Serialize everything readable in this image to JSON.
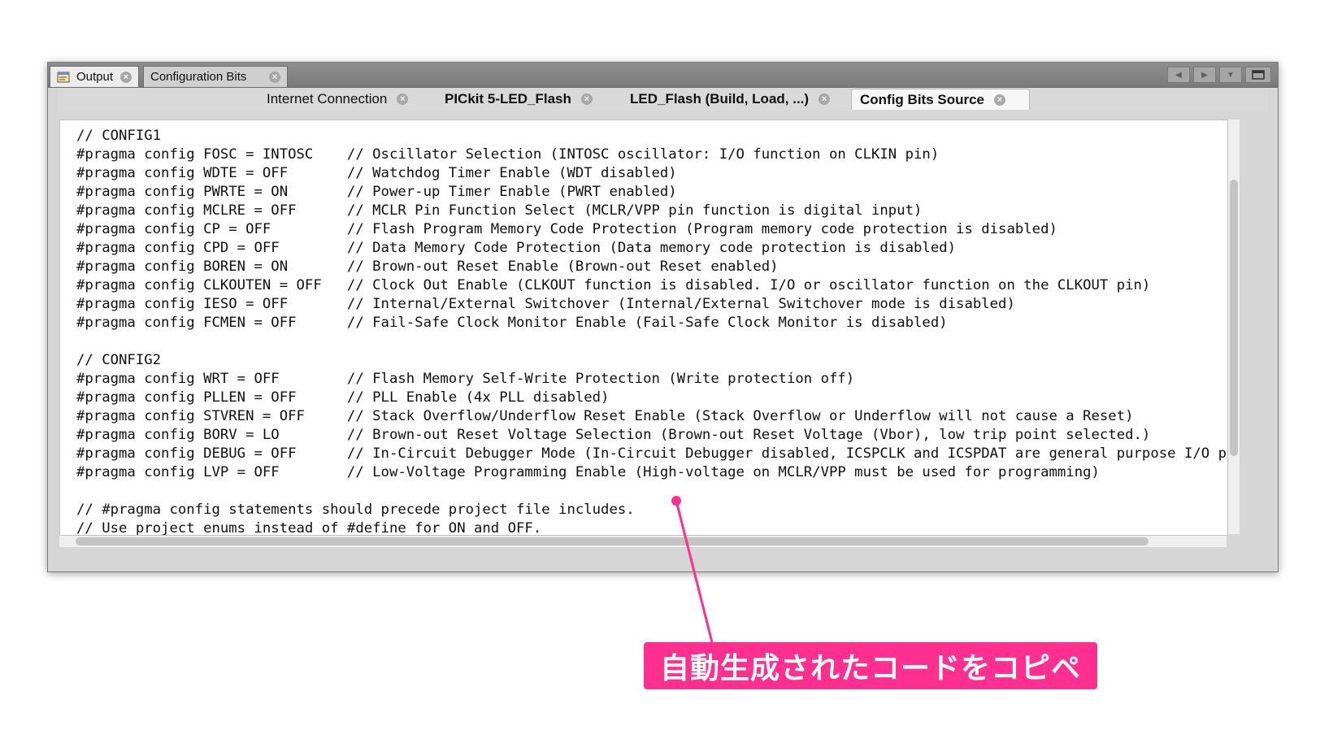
{
  "top_tabs": [
    {
      "label": "Output",
      "icon": "output-window-icon"
    },
    {
      "label": "Configuration Bits"
    }
  ],
  "window_controls": [
    "scroll-left-icon",
    "scroll-right-icon",
    "dropdown-icon",
    "maximize-icon"
  ],
  "sub_tabs": [
    {
      "label": "Internet Connection"
    },
    {
      "label": "PICkit 5-LED_Flash"
    },
    {
      "label": "LED_Flash (Build, Load, ...)"
    },
    {
      "label": "Config Bits Source"
    }
  ],
  "editor": {
    "lines": [
      "// CONFIG1",
      "#pragma config FOSC = INTOSC    // Oscillator Selection (INTOSC oscillator: I/O function on CLKIN pin)",
      "#pragma config WDTE = OFF       // Watchdog Timer Enable (WDT disabled)",
      "#pragma config PWRTE = ON       // Power-up Timer Enable (PWRT enabled)",
      "#pragma config MCLRE = OFF      // MCLR Pin Function Select (MCLR/VPP pin function is digital input)",
      "#pragma config CP = OFF         // Flash Program Memory Code Protection (Program memory code protection is disabled)",
      "#pragma config CPD = OFF        // Data Memory Code Protection (Data memory code protection is disabled)",
      "#pragma config BOREN = ON       // Brown-out Reset Enable (Brown-out Reset enabled)",
      "#pragma config CLKOUTEN = OFF   // Clock Out Enable (CLKOUT function is disabled. I/O or oscillator function on the CLKOUT pin)",
      "#pragma config IESO = OFF       // Internal/External Switchover (Internal/External Switchover mode is disabled)",
      "#pragma config FCMEN = OFF      // Fail-Safe Clock Monitor Enable (Fail-Safe Clock Monitor is disabled)",
      "",
      "// CONFIG2",
      "#pragma config WRT = OFF        // Flash Memory Self-Write Protection (Write protection off)",
      "#pragma config PLLEN = OFF      // PLL Enable (4x PLL disabled)",
      "#pragma config STVREN = OFF     // Stack Overflow/Underflow Reset Enable (Stack Overflow or Underflow will not cause a Reset)",
      "#pragma config BORV = LO        // Brown-out Reset Voltage Selection (Brown-out Reset Voltage (Vbor), low trip point selected.)",
      "#pragma config DEBUG = OFF      // In-Circuit Debugger Mode (In-Circuit Debugger disabled, ICSPCLK and ICSPDAT are general purpose I/O pins)",
      "#pragma config LVP = OFF        // Low-Voltage Programming Enable (High-voltage on MCLR/VPP must be used for programming)",
      "",
      "// #pragma config statements should precede project file includes.",
      "// Use project enums instead of #define for ON and OFF."
    ]
  },
  "annotation": {
    "text": "自動生成されたコードをコピペ",
    "color": "#ff2f8f"
  }
}
